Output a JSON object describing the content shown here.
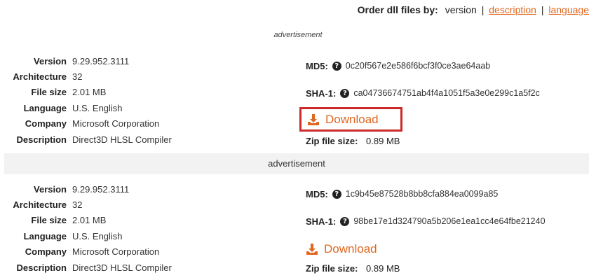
{
  "order": {
    "label": "Order dll files by:",
    "current": "version",
    "sep1": "|",
    "link_description": "description",
    "sep2": "|",
    "link_language": "language"
  },
  "ad_top": "advertisement",
  "ad_band": "advertisement",
  "labels": {
    "version": "Version",
    "architecture": "Architecture",
    "file_size": "File size",
    "language": "Language",
    "company": "Company",
    "description": "Description",
    "md5": "MD5:",
    "sha1": "SHA-1:",
    "zip": "Zip file size:",
    "download": "Download",
    "help_glyph": "?"
  },
  "files": [
    {
      "version": "9.29.952.3111",
      "architecture": "32",
      "file_size": "2.01 MB",
      "language": "U.S. English",
      "company": "Microsoft Corporation",
      "description": "Direct3D HLSL Compiler",
      "md5": "0c20f567e2e586f6bcf3f0ce3ae64aab",
      "sha1": "ca04736674751ab4f4a1051f5a3e0e299c1a5f2c",
      "zip_size": "0.89 MB"
    },
    {
      "version": "9.29.952.3111",
      "architecture": "32",
      "file_size": "2.01 MB",
      "language": "U.S. English",
      "company": "Microsoft Corporation",
      "description": "Direct3D HLSL Compiler",
      "md5": "1c9b45e87528b8bb8cfa884ea0099a85",
      "sha1": "98be17e1d324790a5b206e1ea1cc4e64fbe21240",
      "zip_size": "0.89 MB"
    }
  ],
  "colors": {
    "accent": "#e0671f",
    "highlight_border": "#cc2b2b",
    "ad_band_bg": "#f2f2f2"
  },
  "icons": {
    "download": "download-icon",
    "help": "question-circle-icon"
  }
}
